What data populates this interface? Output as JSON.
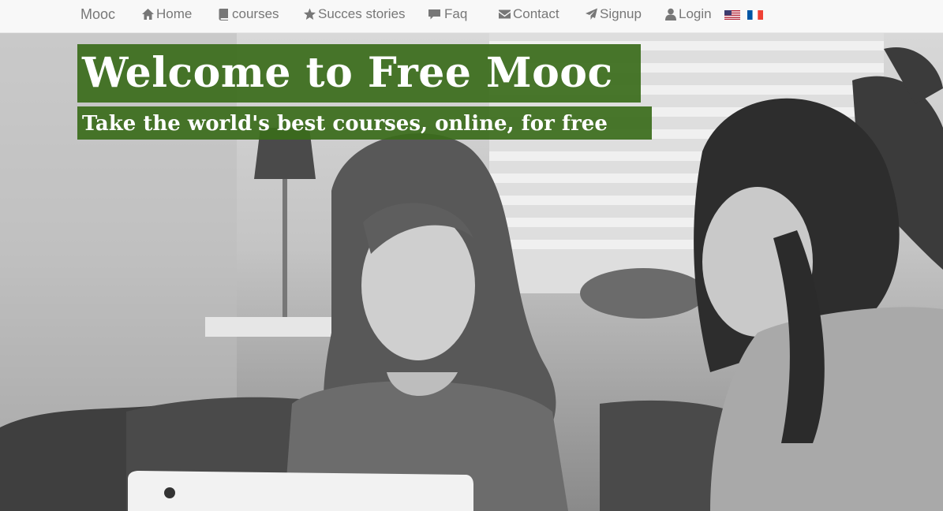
{
  "nav": {
    "brand": "Mooc",
    "items": [
      {
        "label": "Home",
        "icon": "home-icon"
      },
      {
        "label": "courses",
        "icon": "book-icon"
      },
      {
        "label": "Succes stories",
        "icon": "star-icon"
      },
      {
        "label": "Faq",
        "icon": "comment-icon"
      },
      {
        "label": "Contact",
        "icon": "envelope-icon"
      },
      {
        "label": "Signup",
        "icon": "send-icon"
      },
      {
        "label": "Login",
        "icon": "user-icon"
      }
    ],
    "languages": [
      "us-flag-icon",
      "fr-flag-icon"
    ]
  },
  "hero": {
    "title": "Welcome to Free Mooc",
    "subtitle": "Take the world's best courses, online, for free"
  },
  "colors": {
    "banner_green": "#3a6b1a",
    "nav_text": "#777777",
    "nav_bg": "#f8f8f8"
  }
}
